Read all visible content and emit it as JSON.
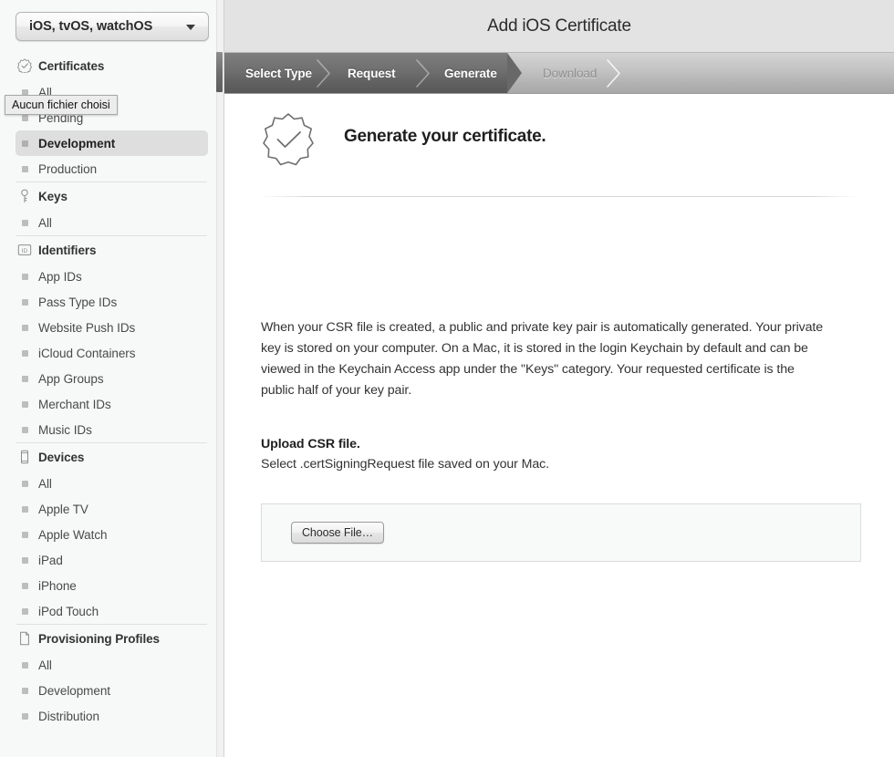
{
  "sidebar": {
    "platform_select": {
      "value": "iOS, tvOS, watchOS",
      "icon": "chevron-down-icon"
    },
    "tooltip": {
      "text": "Aucun fichier choisi"
    },
    "sections": [
      {
        "title": "Certificates",
        "icon": "certificate-badge-icon",
        "items": [
          {
            "label": "All",
            "selected": false
          },
          {
            "label": "Pending",
            "selected": false
          },
          {
            "label": "Development",
            "selected": true
          },
          {
            "label": "Production",
            "selected": false
          }
        ]
      },
      {
        "title": "Keys",
        "icon": "key-icon",
        "items": [
          {
            "label": "All",
            "selected": false
          }
        ]
      },
      {
        "title": "Identifiers",
        "icon": "id-badge-icon",
        "items": [
          {
            "label": "App IDs",
            "selected": false
          },
          {
            "label": "Pass Type IDs",
            "selected": false
          },
          {
            "label": "Website Push IDs",
            "selected": false
          },
          {
            "label": "iCloud Containers",
            "selected": false
          },
          {
            "label": "App Groups",
            "selected": false
          },
          {
            "label": "Merchant IDs",
            "selected": false
          },
          {
            "label": "Music IDs",
            "selected": false
          }
        ]
      },
      {
        "title": "Devices",
        "icon": "device-icon",
        "items": [
          {
            "label": "All",
            "selected": false
          },
          {
            "label": "Apple TV",
            "selected": false
          },
          {
            "label": "Apple Watch",
            "selected": false
          },
          {
            "label": "iPad",
            "selected": false
          },
          {
            "label": "iPhone",
            "selected": false
          },
          {
            "label": "iPod Touch",
            "selected": false
          }
        ]
      },
      {
        "title": "Provisioning Profiles",
        "icon": "document-icon",
        "items": [
          {
            "label": "All",
            "selected": false
          },
          {
            "label": "Development",
            "selected": false
          },
          {
            "label": "Distribution",
            "selected": false
          }
        ]
      }
    ]
  },
  "main": {
    "header": {
      "title": "Add iOS Certificate"
    },
    "steps": [
      {
        "label": "Select Type",
        "state": "done"
      },
      {
        "label": "Request",
        "state": "done"
      },
      {
        "label": "Generate",
        "state": "done"
      },
      {
        "label": "Download",
        "state": "pending"
      }
    ],
    "hero": {
      "icon": "certificate-check-badge-icon",
      "title": "Generate your certificate."
    },
    "body_copy": "When your CSR file is created, a public and private key pair is automatically generated. Your private key is stored on your computer. On a Mac, it is stored in the login Keychain by default and can be viewed in the Keychain Access app under the \"Keys\" category. Your requested certificate is the public half of your key pair.",
    "upload": {
      "title": "Upload CSR file.",
      "subtitle": "Select .certSigningRequest file saved on your Mac.",
      "choose_file_label": "Choose File…"
    }
  },
  "colors": {
    "sidebar_bg": "#f7f8f8",
    "header_bg": "#e3e3e3",
    "step_done_bg": "#686868",
    "step_pending_bg": "#b8b8b8",
    "selected_item_bg": "#dedede",
    "dropzone_bg": "#f8faf9"
  }
}
